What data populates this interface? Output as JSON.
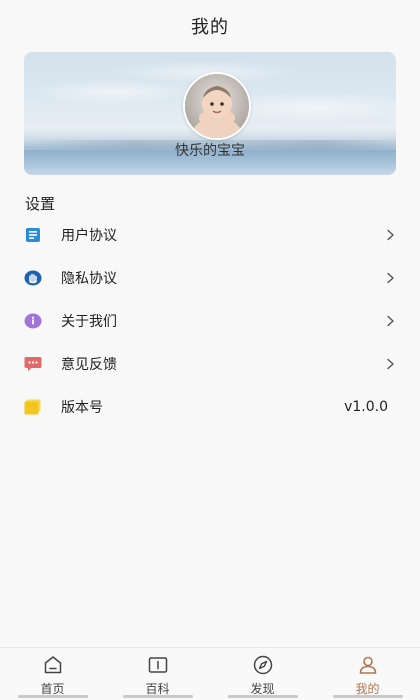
{
  "header": {
    "title": "我的"
  },
  "profile": {
    "username": "快乐的宝宝",
    "avatar_icon": "baby-avatar"
  },
  "settings": {
    "section_title": "设置",
    "items": [
      {
        "label": "用户协议",
        "icon": "document-icon",
        "icon_color": "#2a8bd6",
        "chevron": true
      },
      {
        "label": "隐私协议",
        "icon": "hand-stop-icon",
        "icon_color": "#1d62b0",
        "chevron": true
      },
      {
        "label": "关于我们",
        "icon": "info-icon",
        "icon_color": "#a274d8",
        "chevron": true
      },
      {
        "label": "意见反馈",
        "icon": "message-icon",
        "icon_color": "#e06b6b",
        "chevron": true
      },
      {
        "label": "版本号",
        "icon": "folder-icon",
        "icon_color": "#f2cc2c",
        "value": "v1.0.0"
      }
    ]
  },
  "tabbar": {
    "accent_color": "#b0764f",
    "tabs": [
      {
        "label": "首页",
        "icon": "home-icon",
        "active": false
      },
      {
        "label": "百科",
        "icon": "book-icon",
        "active": false
      },
      {
        "label": "发现",
        "icon": "compass-icon",
        "active": false
      },
      {
        "label": "我的",
        "icon": "user-icon",
        "active": true
      }
    ]
  }
}
